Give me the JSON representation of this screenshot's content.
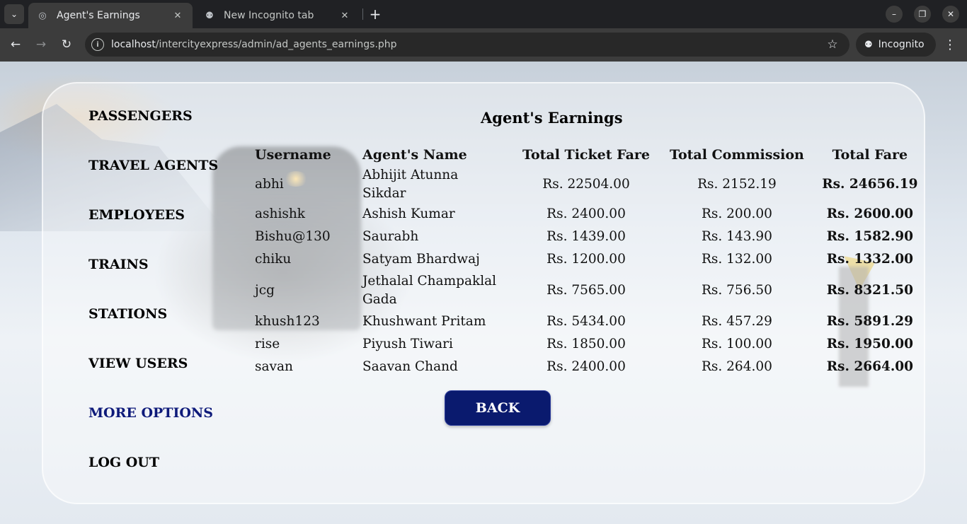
{
  "browser": {
    "tabs": [
      {
        "title": "Agent's Earnings",
        "active": true
      },
      {
        "title": "New Incognito tab",
        "active": false
      }
    ],
    "url_host": "localhost",
    "url_path": "/intercityexpress/admin/ad_agents_earnings.php",
    "incognito_label": "Incognito"
  },
  "nav": {
    "items": [
      {
        "label": "PASSENGERS"
      },
      {
        "label": "TRAVEL AGENTS"
      },
      {
        "label": "EMPLOYEES"
      },
      {
        "label": "TRAINS"
      },
      {
        "label": "STATIONS"
      },
      {
        "label": "VIEW USERS"
      },
      {
        "label": "MORE OPTIONS"
      },
      {
        "label": "LOG OUT"
      }
    ]
  },
  "heading": "Agent's Earnings",
  "table": {
    "headers": [
      "Username",
      "Agent's Name",
      "Total Ticket Fare",
      "Total Commission",
      "Total Fare"
    ],
    "rows": [
      [
        "abhi",
        "Abhijit Atunna Sikdar",
        "Rs. 22504.00",
        "Rs. 2152.19",
        "Rs. 24656.19"
      ],
      [
        "ashishk",
        "Ashish Kumar",
        "Rs. 2400.00",
        "Rs. 200.00",
        "Rs. 2600.00"
      ],
      [
        "Bishu@130",
        "Saurabh",
        "Rs. 1439.00",
        "Rs. 143.90",
        "Rs. 1582.90"
      ],
      [
        "chiku",
        "Satyam Bhardwaj",
        "Rs. 1200.00",
        "Rs. 132.00",
        "Rs. 1332.00"
      ],
      [
        "jcg",
        "Jethalal Champaklal Gada",
        "Rs. 7565.00",
        "Rs. 756.50",
        "Rs. 8321.50"
      ],
      [
        "khush123",
        "Khushwant Pritam",
        "Rs. 5434.00",
        "Rs. 457.29",
        "Rs. 5891.29"
      ],
      [
        "rise",
        "Piyush Tiwari",
        "Rs. 1850.00",
        "Rs. 100.00",
        "Rs. 1950.00"
      ],
      [
        "savan",
        "Saavan Chand",
        "Rs. 2400.00",
        "Rs. 264.00",
        "Rs. 2664.00"
      ]
    ]
  },
  "back_label": "BACK",
  "colors": {
    "active_nav": "#0e1a7a",
    "back_button": "#0a1a6e"
  }
}
